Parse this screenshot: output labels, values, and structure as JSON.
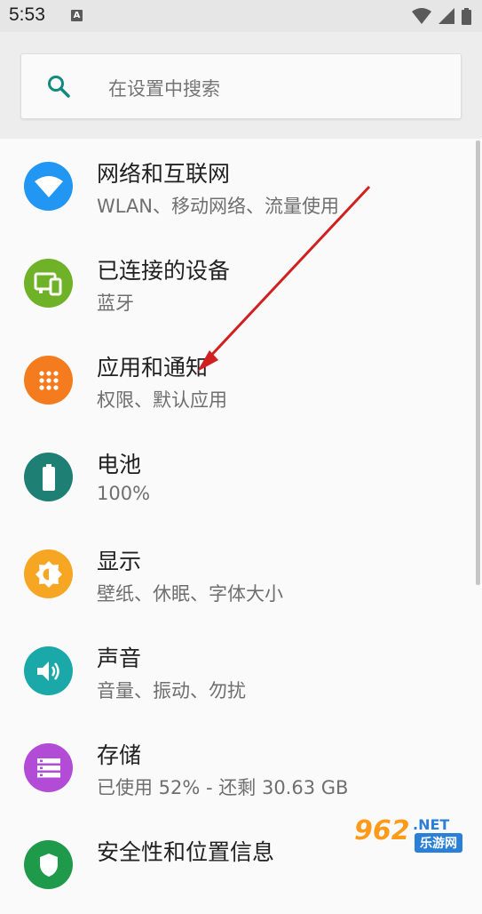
{
  "status_bar": {
    "time": "5:53",
    "notification_icon": "A"
  },
  "search": {
    "placeholder": "在设置中搜索"
  },
  "settings": [
    {
      "title": "网络和互联网",
      "subtitle": "WLAN、移动网络、流量使用",
      "icon": "wifi-icon",
      "color": "#2196f3"
    },
    {
      "title": "已连接的设备",
      "subtitle": "蓝牙",
      "icon": "devices-icon",
      "color": "#6fb227"
    },
    {
      "title": "应用和通知",
      "subtitle": "权限、默认应用",
      "icon": "apps-icon",
      "color": "#f57c1e"
    },
    {
      "title": "电池",
      "subtitle": "100%",
      "icon": "battery-icon",
      "color": "#1e7f74"
    },
    {
      "title": "显示",
      "subtitle": "壁纸、休眠、字体大小",
      "icon": "brightness-icon",
      "color": "#f6a623"
    },
    {
      "title": "声音",
      "subtitle": "音量、振动、勿扰",
      "icon": "volume-icon",
      "color": "#1aa8a8"
    },
    {
      "title": "存储",
      "subtitle": "已使用 52% - 还剩 30.63 GB",
      "icon": "storage-icon",
      "color": "#b24bd6"
    },
    {
      "title": "安全性和位置信息",
      "subtitle": "",
      "icon": "security-icon",
      "color": "#1f9a4a"
    }
  ],
  "watermark": {
    "number": "962",
    "suffix": ".NET",
    "label": "乐游网"
  }
}
